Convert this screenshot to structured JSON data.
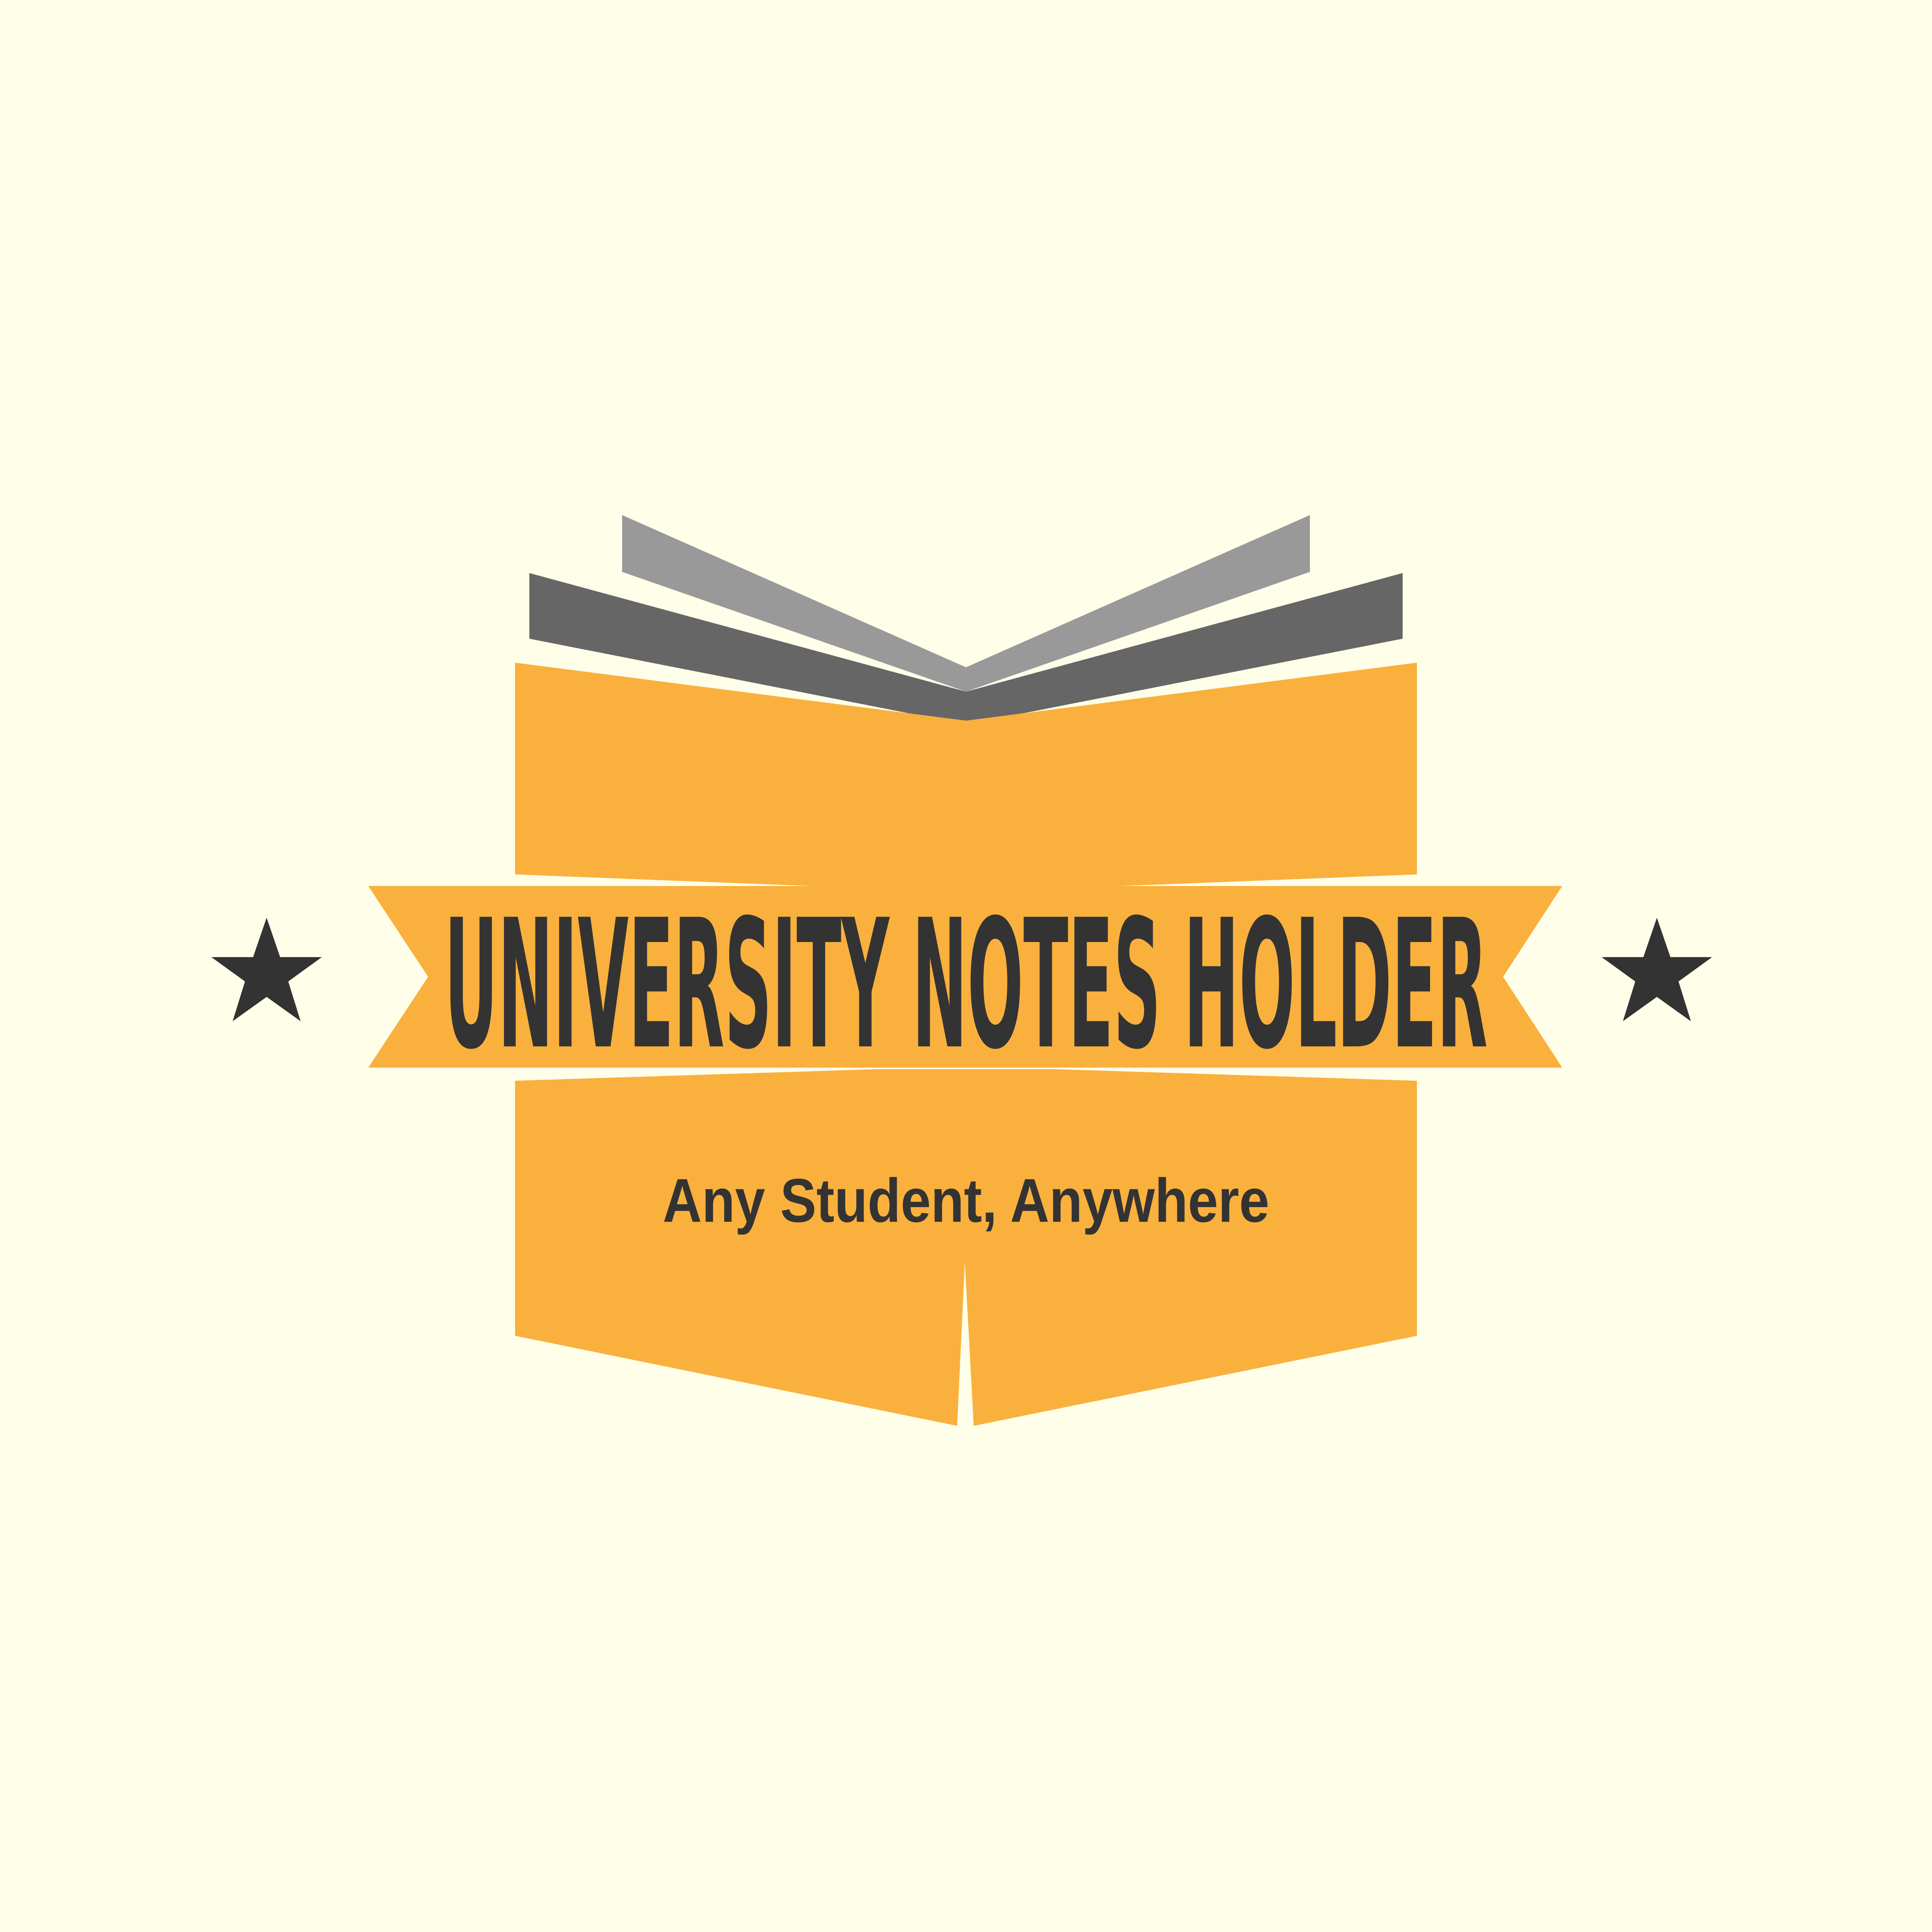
{
  "logo": {
    "title": "UNIVERSITY NOTES HOLDER",
    "tagline": "Any Student, Anywhere",
    "icons": {
      "book": "open-book-icon",
      "star_left": "star-icon",
      "star_right": "star-icon"
    }
  },
  "colors": {
    "background": "#fefee9",
    "book_orange": "#fab03d",
    "page_light": "#999999",
    "page_dark": "#666666",
    "text_dark": "#333333"
  }
}
